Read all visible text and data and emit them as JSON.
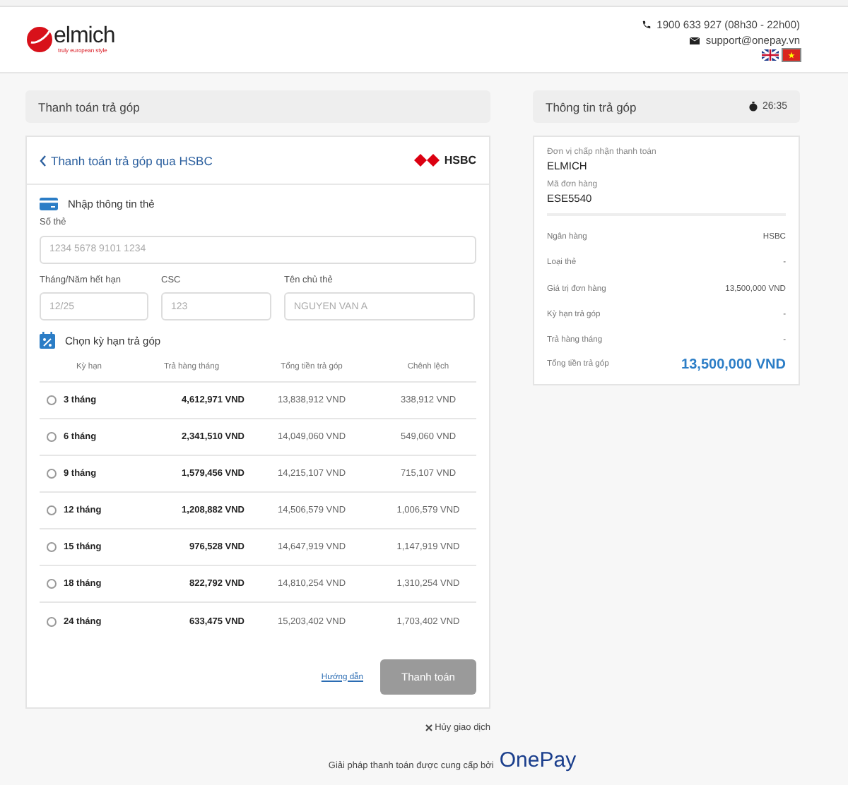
{
  "header": {
    "logo": {
      "brand": "elmich",
      "tagline": "truly european style"
    },
    "phone": "1900 633 927 (08h30 - 22h00)",
    "email": "support@onepay.vn",
    "languages": [
      {
        "kind": "en",
        "selected": false
      },
      {
        "kind": "vi",
        "selected": true
      }
    ]
  },
  "left_panel": {
    "title": "Thanh toán trả góp"
  },
  "right_panel": {
    "title": "Thông tin trả góp",
    "timer": "26:35"
  },
  "card": {
    "back_title": "Thanh toán trả góp qua HSBC",
    "bank_logo": "HSBC",
    "card_section": "Nhập thông tin thẻ",
    "fields": [
      {
        "label": "Số thẻ",
        "placeholder": "1234 5678 9101 1234"
      },
      {
        "label": "Tháng/Năm hết hạn",
        "placeholder": "12/25"
      },
      {
        "label": "CSC",
        "placeholder": "123"
      },
      {
        "label": "Tên chủ thẻ",
        "placeholder": "NGUYEN VAN A"
      }
    ],
    "term_section": "Chọn kỳ hạn trả góp",
    "table": {
      "columns": [
        "Kỳ hạn",
        "Trả hàng tháng",
        "Tổng tiền trả góp",
        "Chênh lệch"
      ],
      "rows": [
        {
          "term": "3 tháng",
          "monthly": "4,612,971 VND",
          "total": "13,838,912 VND",
          "diff": "338,912 VND",
          "selected": false
        },
        {
          "term": "6 tháng",
          "monthly": "2,341,510 VND",
          "total": "14,049,060 VND",
          "diff": "549,060 VND",
          "selected": false
        },
        {
          "term": "9 tháng",
          "monthly": "1,579,456 VND",
          "total": "14,215,107 VND",
          "diff": "715,107 VND",
          "selected": false
        },
        {
          "term": "12 tháng",
          "monthly": "1,208,882 VND",
          "total": "14,506,579 VND",
          "diff": "1,006,579 VND",
          "selected": false
        },
        {
          "term": "15 tháng",
          "monthly": "976,528 VND",
          "total": "14,647,919 VND",
          "diff": "1,147,919 VND",
          "selected": false
        },
        {
          "term": "18 tháng",
          "monthly": "822,792 VND",
          "total": "14,810,254 VND",
          "diff": "1,310,254 VND",
          "selected": false
        },
        {
          "term": "24 tháng",
          "monthly": "633,475 VND",
          "total": "15,203,402 VND",
          "diff": "1,703,402 VND",
          "selected": false
        }
      ]
    },
    "guide_link": "Hướng dẫn",
    "pay_button": {
      "label": "Thanh toán",
      "disabled": true
    }
  },
  "cancel": "Hủy giao dịch",
  "summary": {
    "merchant_label": "Đơn vị chấp nhận thanh toán",
    "merchant": "ELMICH",
    "order_label": "Mã đơn hàng",
    "order": "ESE5540",
    "rows": [
      {
        "label": "Ngân hàng",
        "value": "HSBC",
        "kind": "plain"
      },
      {
        "label": "Loại thẻ",
        "value": "-",
        "kind": "plain"
      },
      {
        "label": "Giá trị đơn hàng",
        "value": "13,500,000 VND",
        "kind": "plain"
      },
      {
        "label": "Kỳ hạn trả góp",
        "value": "-",
        "kind": "plain"
      },
      {
        "label": "Trả hàng tháng",
        "value": "-",
        "kind": "plain"
      },
      {
        "label": "Tổng tiền trả góp",
        "value": "13,500,000 VND",
        "kind": "total"
      }
    ]
  },
  "footer": {
    "text": "Giải pháp thanh toán được cung cấp bởi",
    "brand": "OnePay"
  }
}
